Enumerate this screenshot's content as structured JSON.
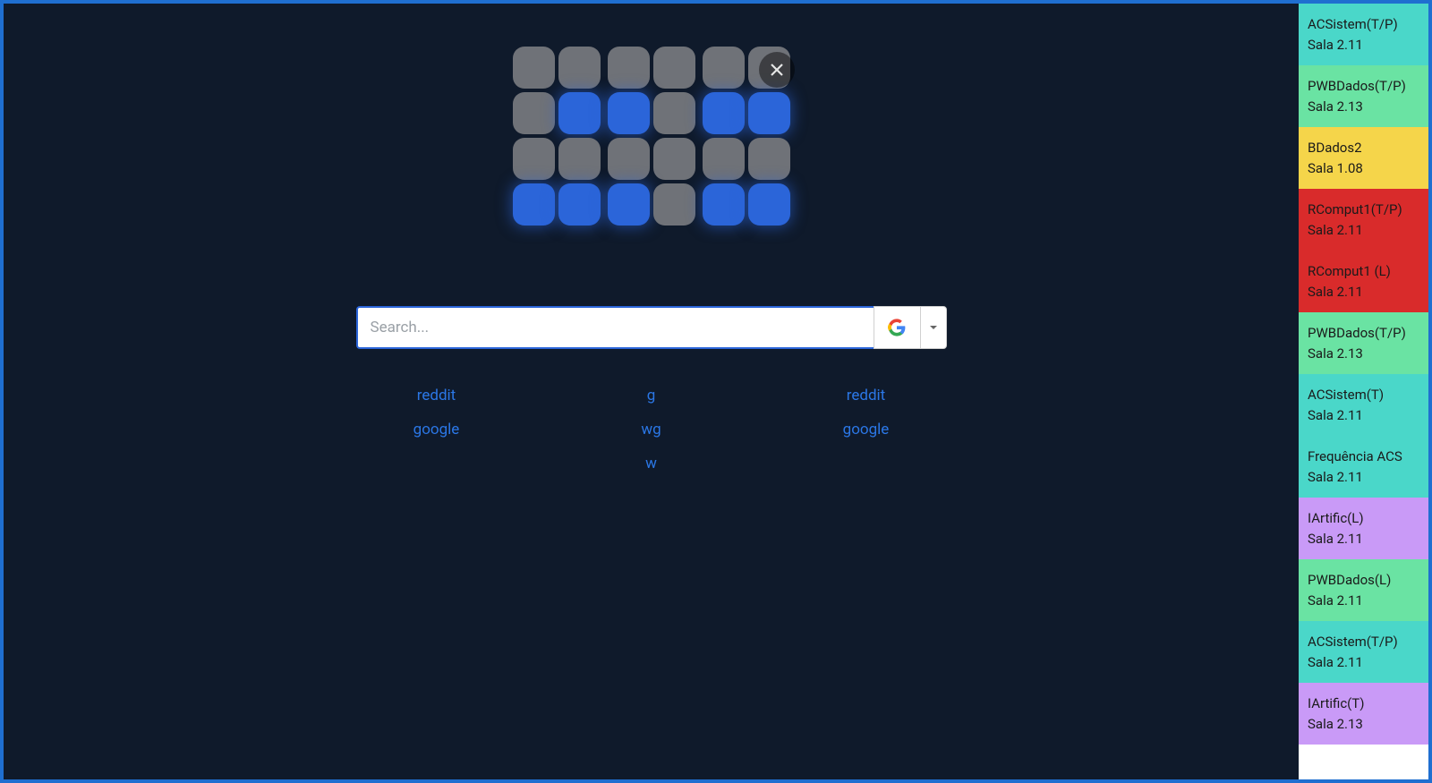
{
  "clock": {
    "pattern": [
      [
        0,
        0,
        0,
        0,
        0,
        0,
        0,
        0
      ],
      [
        0,
        1,
        1,
        0,
        1,
        1,
        0,
        0
      ],
      [
        0,
        0,
        0,
        0,
        0,
        0,
        0,
        0
      ],
      [
        1,
        1,
        1,
        0,
        1,
        1,
        0,
        0
      ]
    ],
    "rows": 4,
    "cols": 8,
    "columnsVisible": 8,
    "hiddenLastGroup": true
  },
  "close_icon_name": "close-icon",
  "search": {
    "placeholder": "Search...",
    "value": "",
    "engine": "google"
  },
  "quicklinks": [
    [
      "reddit",
      "google"
    ],
    [
      "g",
      "wg",
      "w"
    ],
    [
      "reddit",
      "google"
    ]
  ],
  "sidebar": [
    {
      "title": "ACSistem(T/P)",
      "room": "Sala 2.11",
      "color": "#4ad7c9"
    },
    {
      "title": "PWBDados(T/P)",
      "room": "Sala 2.13",
      "color": "#6ae3a3"
    },
    {
      "title": "BDados2",
      "room": "Sala 1.08",
      "color": "#f5d54a"
    },
    {
      "title": "RComput1(T/P)",
      "room": "Sala 2.11",
      "color": "#d92b2b"
    },
    {
      "title": "RComput1 (L)",
      "room": "Sala 2.11",
      "color": "#d92b2b"
    },
    {
      "title": "PWBDados(T/P)",
      "room": "Sala 2.13",
      "color": "#6ae3a3"
    },
    {
      "title": "ACSistem(T)",
      "room": "Sala 2.11",
      "color": "#4ad7c9"
    },
    {
      "title": "Frequência ACS",
      "room": "Sala 2.11",
      "color": "#4ad7c9"
    },
    {
      "title": "IArtific(L)",
      "room": "Sala 2.11",
      "color": "#c99af7"
    },
    {
      "title": "PWBDados(L)",
      "room": "Sala 2.11",
      "color": "#6ae3a3"
    },
    {
      "title": "ACSistem(T/P)",
      "room": "Sala 2.11",
      "color": "#4ad7c9"
    },
    {
      "title": "IArtific(T)",
      "room": "Sala 2.13",
      "color": "#c99af7"
    }
  ]
}
